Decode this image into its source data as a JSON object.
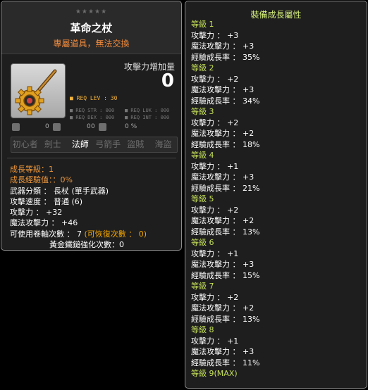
{
  "item": {
    "stars": "★★★★★",
    "title": "革命之杖",
    "untradeable": "專屬道具，無法交換",
    "atk_increase_label": "攻擊力增加量",
    "atk_increase_value": "0",
    "req_lev": "■ REQ LEV :  30",
    "req_str": "■ REQ STR : 000",
    "req_luk": "■ REQ LUK : 000",
    "req_dex": "■ REQ DEX : 000",
    "req_int": "■ REQ INT : 000",
    "small_values": [
      "0",
      "0",
      "0",
      "0 %"
    ],
    "small_icon_names": [
      "cube-icon",
      "bag-icon",
      "potential-icon",
      "lock-icon"
    ],
    "jobs": [
      "初心者",
      "劍士",
      "法師",
      "弓箭手",
      "盜賊",
      "海盜"
    ],
    "active_job": "法師"
  },
  "stats": {
    "growth_level": "成長等級：1",
    "growth_exp": "成長經驗值：：0%",
    "weapon_type": "武器分類 ： 長杖 (單手武器)",
    "attack_speed": "攻擊速度 ： 普通 (6)",
    "attack": "攻擊力 ： +32",
    "magic_attack": "魔法攻擊力 ： +46",
    "upgrades_prefix": "可使用卷軸次數 ： 7",
    "upgrades_suffix": "(可恢復次數 ： 0)",
    "hammer": "黃金鐵鎚強化次數：0"
  },
  "growth": {
    "title": "裝備成長屬性",
    "levels": [
      {
        "label": "等級 1",
        "rows": [
          "攻擊力 ： +3",
          "魔法攻擊力 ： +3",
          "經驗成長率 ： 35%"
        ]
      },
      {
        "label": "等級 2",
        "rows": [
          "攻擊力 ： +2",
          "魔法攻擊力 ： +3",
          "經驗成長率 ： 34%"
        ]
      },
      {
        "label": "等級 3",
        "rows": [
          "攻擊力 ： +2",
          "魔法攻擊力 ： +2",
          "經驗成長率 ： 18%"
        ]
      },
      {
        "label": "等級 4",
        "rows": [
          "攻擊力 ： +1",
          "魔法攻擊力 ： +3",
          "經驗成長率 ： 21%"
        ]
      },
      {
        "label": "等級 5",
        "rows": [
          "攻擊力 ： +2",
          "魔法攻擊力 ： +2",
          "經驗成長率 ： 13%"
        ]
      },
      {
        "label": "等級 6",
        "rows": [
          "攻擊力 ： +1",
          "魔法攻擊力 ： +3",
          "經驗成長率 ： 15%"
        ]
      },
      {
        "label": "等級 7",
        "rows": [
          "攻擊力 ： +2",
          "魔法攻擊力 ： +2",
          "經驗成長率 ： 13%"
        ]
      },
      {
        "label": "等級 8",
        "rows": [
          "攻擊力 ： +1",
          "魔法攻擊力 ： +3",
          "經驗成長率 ： 11%"
        ]
      },
      {
        "label": "等級 9(MAX)",
        "rows": []
      }
    ]
  }
}
